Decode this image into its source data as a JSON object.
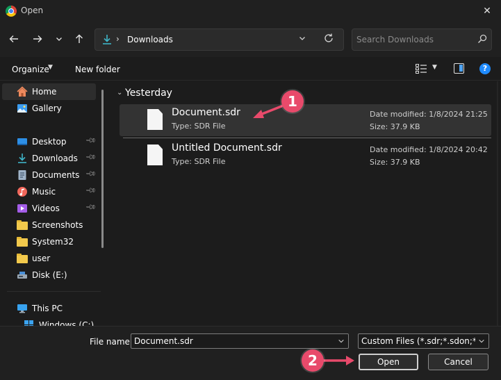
{
  "window": {
    "title": "Open",
    "close_glyph": "✕"
  },
  "toolbar": {
    "back_icon": "arrow-left-icon",
    "forward_icon": "arrow-right-icon",
    "recent_icon": "chevron-down-icon",
    "up_icon": "arrow-up-icon"
  },
  "address": {
    "location": "Downloads",
    "separator": "›"
  },
  "search": {
    "placeholder": "Search Downloads"
  },
  "commands": {
    "organize": "Organize",
    "new_folder": "New folder",
    "help": "?"
  },
  "sidebar": {
    "items": [
      {
        "label": "Home",
        "icon": "home-icon",
        "pinned": false,
        "selected": true
      },
      {
        "label": "Gallery",
        "icon": "gallery-icon",
        "pinned": false
      },
      {
        "label": "Desktop",
        "icon": "desktop-icon",
        "pinned": true
      },
      {
        "label": "Downloads",
        "icon": "download-icon",
        "pinned": true
      },
      {
        "label": "Documents",
        "icon": "documents-icon",
        "pinned": true
      },
      {
        "label": "Music",
        "icon": "music-icon",
        "pinned": true
      },
      {
        "label": "Videos",
        "icon": "videos-icon",
        "pinned": true
      },
      {
        "label": "Screenshots",
        "icon": "folder-icon",
        "pinned": false
      },
      {
        "label": "System32",
        "icon": "folder-icon",
        "pinned": false
      },
      {
        "label": "user",
        "icon": "folder-icon",
        "pinned": false
      },
      {
        "label": "Disk (E:)",
        "icon": "drive-icon",
        "pinned": false
      },
      {
        "label": "This PC",
        "icon": "pc-icon",
        "pinned": false
      },
      {
        "label": "Windows (C:)",
        "icon": "windows-drive-icon",
        "pinned": false
      }
    ]
  },
  "files": {
    "group": "Yesterday",
    "items": [
      {
        "name": "Document.sdr",
        "type": "Type: SDR File",
        "modified": "Date modified: 1/8/2024 21:25",
        "size": "Size: 37.9 KB",
        "selected": true
      },
      {
        "name": "Untitled Document.sdr",
        "type": "Type: SDR File",
        "modified": "Date modified: 1/8/2024 20:42",
        "size": "Size: 37.9 KB",
        "selected": false
      }
    ]
  },
  "footer": {
    "file_name_label": "File name:",
    "file_name_value": "Document.sdr",
    "filter_value": "Custom Files (*.sdr;*.sdon;*.vso",
    "open_label": "Open",
    "cancel_label": "Cancel"
  },
  "annotations": {
    "step1": "1",
    "step2": "2",
    "color": "#e84a6b"
  }
}
